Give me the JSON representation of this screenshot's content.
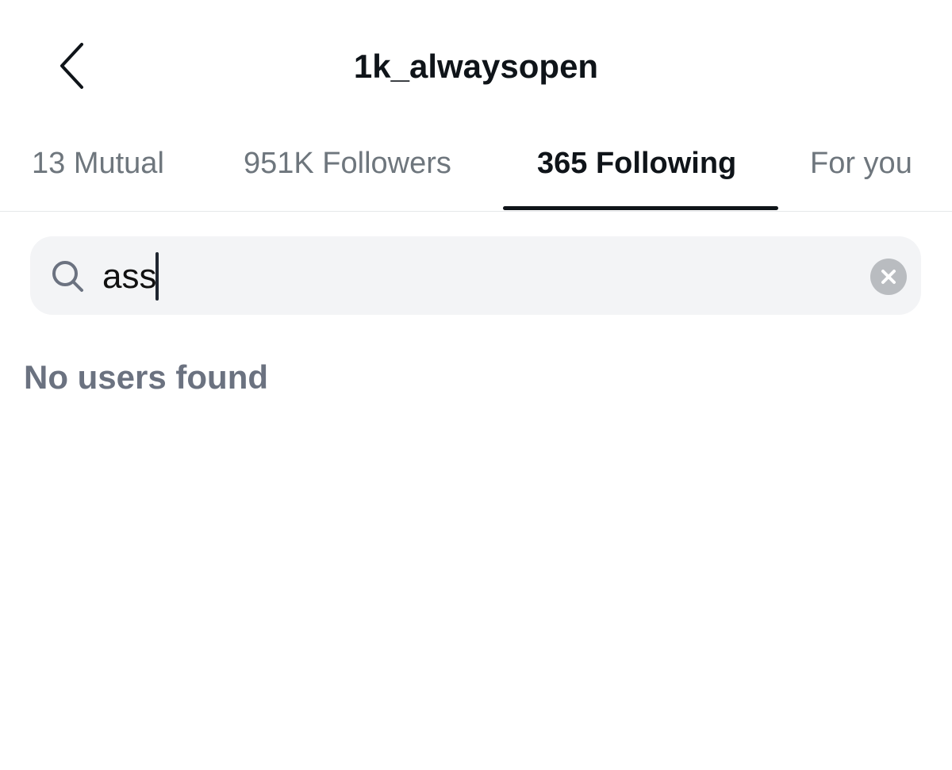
{
  "header": {
    "title": "1k_alwaysopen",
    "back_icon": "chevron-left-icon"
  },
  "tabs": [
    {
      "label": "13 Mutual",
      "active": false
    },
    {
      "label": "951K Followers",
      "active": false
    },
    {
      "label": "365 Following",
      "active": true
    },
    {
      "label": "For you",
      "active": false
    }
  ],
  "search": {
    "icon": "search-icon",
    "value": "ass",
    "clear_icon": "clear-icon"
  },
  "results": {
    "empty_message": "No users found"
  },
  "colors": {
    "text_primary": "#0f1419",
    "text_secondary": "#6e767d",
    "empty_text": "#6b7280",
    "search_background": "#f3f4f6",
    "clear_button_background": "#b9bcc0",
    "divider": "#e6e8ea"
  }
}
